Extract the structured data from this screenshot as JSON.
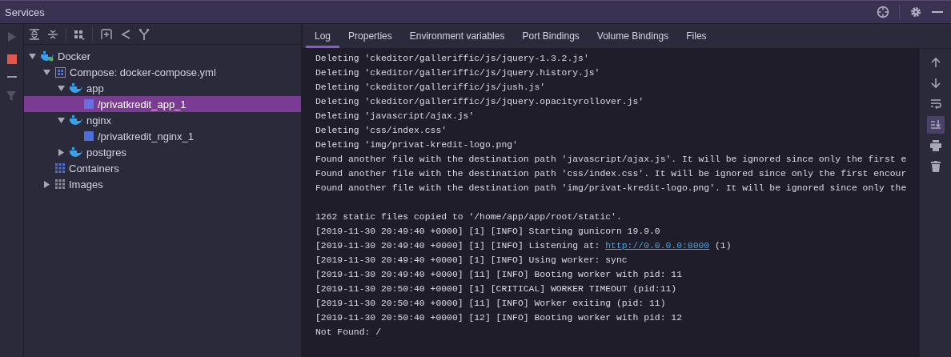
{
  "window": {
    "title": "Services"
  },
  "title_tools": [
    {
      "kind": "target"
    },
    {
      "kind": "gear"
    },
    {
      "kind": "hide"
    }
  ],
  "side_tools": [
    {
      "kind": "run",
      "disabled": true
    },
    {
      "kind": "stop",
      "disabled": false
    },
    {
      "kind": "minus",
      "disabled": false
    },
    {
      "kind": "filter",
      "disabled": true
    }
  ],
  "tree_tools": [
    {
      "kind": "expand"
    },
    {
      "kind": "collapse"
    },
    {
      "kind": "group"
    },
    {
      "kind": "add"
    },
    {
      "kind": "split"
    },
    {
      "kind": "merge"
    }
  ],
  "tree": [
    {
      "label": "Docker",
      "kind": "docker",
      "expanded": true,
      "selected": false,
      "children": [
        {
          "label": "Compose: docker-compose.yml",
          "kind": "compose",
          "expanded": true,
          "selected": false,
          "children": [
            {
              "label": "app",
              "kind": "service",
              "expanded": true,
              "selected": false,
              "children": [
                {
                  "label": "/privatkredit_app_1",
                  "kind": "container",
                  "selected": true
                }
              ]
            },
            {
              "label": "nginx",
              "kind": "service",
              "expanded": true,
              "selected": false,
              "children": [
                {
                  "label": "/privatkredit_nginx_1",
                  "kind": "container",
                  "selected": false
                }
              ]
            },
            {
              "label": "postgres",
              "kind": "service",
              "expanded": false,
              "selected": false
            }
          ]
        },
        {
          "label": "Containers",
          "kind": "containers",
          "selected": false
        },
        {
          "label": "Images",
          "kind": "images",
          "expanded": false,
          "selected": false
        }
      ]
    }
  ],
  "tabs": [
    {
      "label": "Log",
      "selected": true
    },
    {
      "label": "Properties",
      "selected": false
    },
    {
      "label": "Environment variables",
      "selected": false
    },
    {
      "label": "Port Bindings",
      "selected": false
    },
    {
      "label": "Volume Bindings",
      "selected": false
    },
    {
      "label": "Files",
      "selected": false
    }
  ],
  "log": [
    {
      "lines": [
        {
          "text": "Deleting 'ckeditor/galleriffic/js/jquery-1.3.2.js'"
        },
        {
          "text": "Deleting 'ckeditor/galleriffic/js/jquery.history.js'"
        },
        {
          "text": "Deleting 'ckeditor/galleriffic/js/jush.js'"
        },
        {
          "text": "Deleting 'ckeditor/galleriffic/js/jquery.opacityrollover.js'"
        },
        {
          "text": "Deleting 'javascript/ajax.js'"
        },
        {
          "text": "Deleting 'css/index.css'"
        },
        {
          "text": "Deleting 'img/privat-kredit-logo.png'"
        },
        {
          "text": "Found another file with the destination path 'javascript/ajax.js'. It will be ignored since only the first e"
        },
        {
          "text": "Found another file with the destination path 'css/index.css'. It will be ignored since only the first encour"
        },
        {
          "text": "Found another file with the destination path 'img/privat-kredit-logo.png'. It will be ignored since only the"
        }
      ]
    },
    {
      "lines": [
        {
          "text": "1262 static files copied to '/home/app/app/root/static'."
        },
        {
          "text": "[2019-11-30 20:49:40 +0000] [1] [INFO] Starting gunicorn 19.9.0"
        },
        {
          "text": "[2019-11-30 20:49:40 +0000] [1] [INFO] Listening at: ",
          "link": "http://0.0.0.0:8000",
          "text_after": " (1)"
        },
        {
          "text": "[2019-11-30 20:49:40 +0000] [1] [INFO] Using worker: sync"
        },
        {
          "text": "[2019-11-30 20:49:40 +0000] [11] [INFO] Booting worker with pid: 11"
        },
        {
          "text": "[2019-11-30 20:50:40 +0000] [1] [CRITICAL] WORKER TIMEOUT (pid:11)"
        },
        {
          "text": "[2019-11-30 20:50:40 +0000] [11] [INFO] Worker exiting (pid: 11)"
        },
        {
          "text": "[2019-11-30 20:50:40 +0000] [12] [INFO] Booting worker with pid: 12"
        },
        {
          "text": "Not Found: /"
        }
      ]
    }
  ],
  "log_tools": [
    {
      "kind": "up",
      "on": false
    },
    {
      "kind": "down",
      "on": false
    },
    {
      "kind": "wrap",
      "on": false
    },
    {
      "kind": "scroll-end",
      "on": true
    },
    {
      "kind": "print",
      "on": false
    },
    {
      "kind": "trash",
      "on": false
    }
  ]
}
